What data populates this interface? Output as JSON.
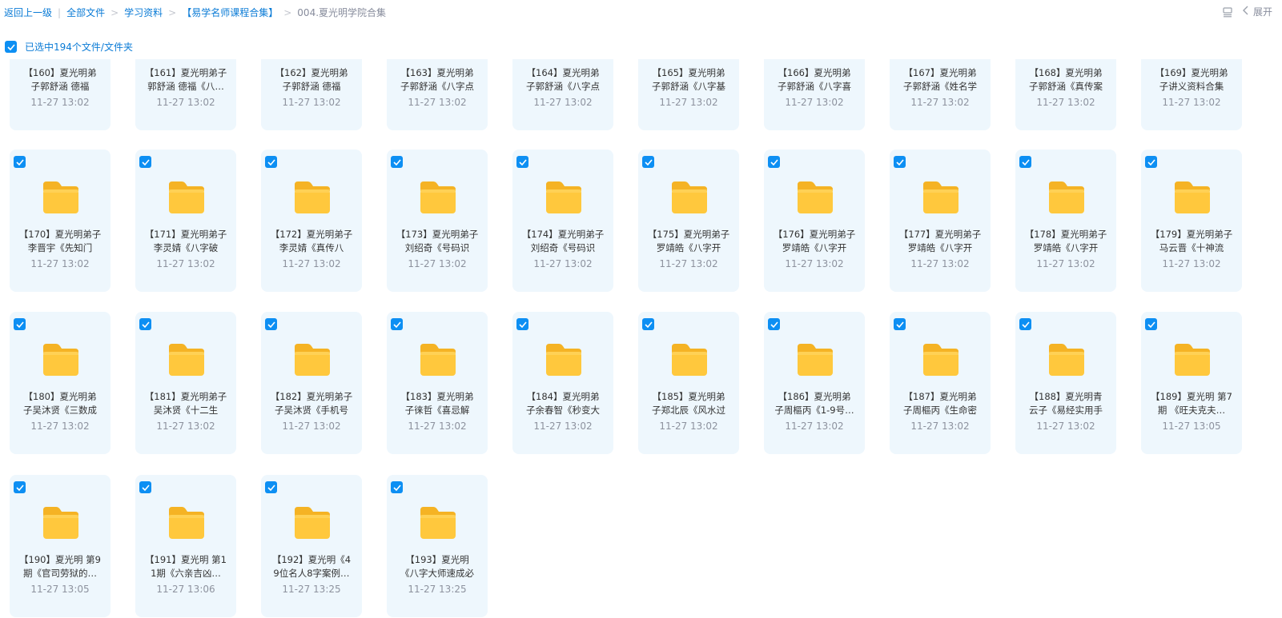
{
  "breadcrumb": {
    "back": "返回上一级",
    "items": [
      "全部文件",
      "学习资料",
      "【易学名师课程合集】",
      "004.夏光明学院合集"
    ]
  },
  "toolbar": {
    "expand_label": "展开"
  },
  "selection": {
    "label": "已选中194个文件/文件夹",
    "checked": true
  },
  "colors": {
    "accent": "#0d8ff3",
    "link": "#0a7bd6",
    "card_bg": "#eef7fd",
    "folder": "#ffc83d"
  },
  "files": [
    {
      "line1": "【160】夏光明弟",
      "line2": "子郭舒涵 德福",
      "time": "11-27 13:02"
    },
    {
      "line1": "【161】夏光明弟子",
      "line2": "郭舒涵 德福《八…",
      "time": "11-27 13:02"
    },
    {
      "line1": "【162】夏光明弟",
      "line2": "子郭舒涵 德福",
      "time": "11-27 13:02"
    },
    {
      "line1": "【163】夏光明弟",
      "line2": "子郭舒涵《八字点",
      "time": "11-27 13:02"
    },
    {
      "line1": "【164】夏光明弟",
      "line2": "子郭舒涵《八字点",
      "time": "11-27 13:02"
    },
    {
      "line1": "【165】夏光明弟",
      "line2": "子郭舒涵《八字基",
      "time": "11-27 13:02"
    },
    {
      "line1": "【166】夏光明弟",
      "line2": "子郭舒涵《八字喜",
      "time": "11-27 13:02"
    },
    {
      "line1": "【167】夏光明弟",
      "line2": "子郭舒涵《姓名学",
      "time": "11-27 13:02"
    },
    {
      "line1": "【168】夏光明弟",
      "line2": "子郭舒涵《真传案",
      "time": "11-27 13:02"
    },
    {
      "line1": "【169】夏光明弟",
      "line2": "子讲义资料合集",
      "time": "11-27 13:02"
    },
    {
      "line1": "【170】夏光明弟子",
      "line2": "李晋宇《先知门",
      "time": "11-27 13:02"
    },
    {
      "line1": "【171】夏光明弟子",
      "line2": "李灵婧《八字破",
      "time": "11-27 13:02"
    },
    {
      "line1": "【172】夏光明弟子",
      "line2": "李灵婧《真传八",
      "time": "11-27 13:02"
    },
    {
      "line1": "【173】夏光明弟子",
      "line2": "刘绍奇《号码识",
      "time": "11-27 13:02"
    },
    {
      "line1": "【174】夏光明弟子",
      "line2": "刘绍奇《号码识",
      "time": "11-27 13:02"
    },
    {
      "line1": "【175】夏光明弟子",
      "line2": "罗靖皓《八字开",
      "time": "11-27 13:02"
    },
    {
      "line1": "【176】夏光明弟子",
      "line2": "罗靖皓《八字开",
      "time": "11-27 13:02"
    },
    {
      "line1": "【177】夏光明弟子",
      "line2": "罗靖皓《八字开",
      "time": "11-27 13:02"
    },
    {
      "line1": "【178】夏光明弟子",
      "line2": "罗靖皓《八字开",
      "time": "11-27 13:02"
    },
    {
      "line1": "【179】夏光明弟子",
      "line2": "马云晋《十神流",
      "time": "11-27 13:02"
    },
    {
      "line1": "【180】夏光明弟",
      "line2": "子吴沐贤《三数成",
      "time": "11-27 13:02"
    },
    {
      "line1": "【181】夏光明弟子",
      "line2": "吴沐贤《十二生",
      "time": "11-27 13:02"
    },
    {
      "line1": "【182】夏光明弟子",
      "line2": "子吴沐贤《手机号",
      "time": "11-27 13:02"
    },
    {
      "line1": "【183】夏光明弟",
      "line2": "子徕哲《喜忌解",
      "time": "11-27 13:02"
    },
    {
      "line1": "【184】夏光明弟",
      "line2": "子余春智《秒变大",
      "time": "11-27 13:02"
    },
    {
      "line1": "【185】夏光明弟",
      "line2": "子郑北辰《风水过",
      "time": "11-27 13:02"
    },
    {
      "line1": "【186】夏光明弟",
      "line2": "子周樞丙《1-9号…",
      "time": "11-27 13:02"
    },
    {
      "line1": "【187】夏光明弟",
      "line2": "子周樞丙《生命密",
      "time": "11-27 13:02"
    },
    {
      "line1": "【188】夏光明青",
      "line2": "云子《易经实用手",
      "time": "11-27 13:02"
    },
    {
      "line1": "【189】夏光明 第7",
      "line2": "期 《旺夫克夫…",
      "time": "11-27 13:05"
    },
    {
      "line1": "【190】夏光明 第9",
      "line2": "期《官司劳狱的…",
      "time": "11-27 13:05"
    },
    {
      "line1": "【191】夏光明 第1",
      "line2": "1期《六亲吉凶…",
      "time": "11-27 13:06"
    },
    {
      "line1": "【192】夏光明《4",
      "line2": "9位名人8字案例…",
      "time": "11-27 13:25"
    },
    {
      "line1": "【193】夏光明",
      "line2": "《八字大师速成必",
      "time": "11-27 13:25"
    }
  ]
}
